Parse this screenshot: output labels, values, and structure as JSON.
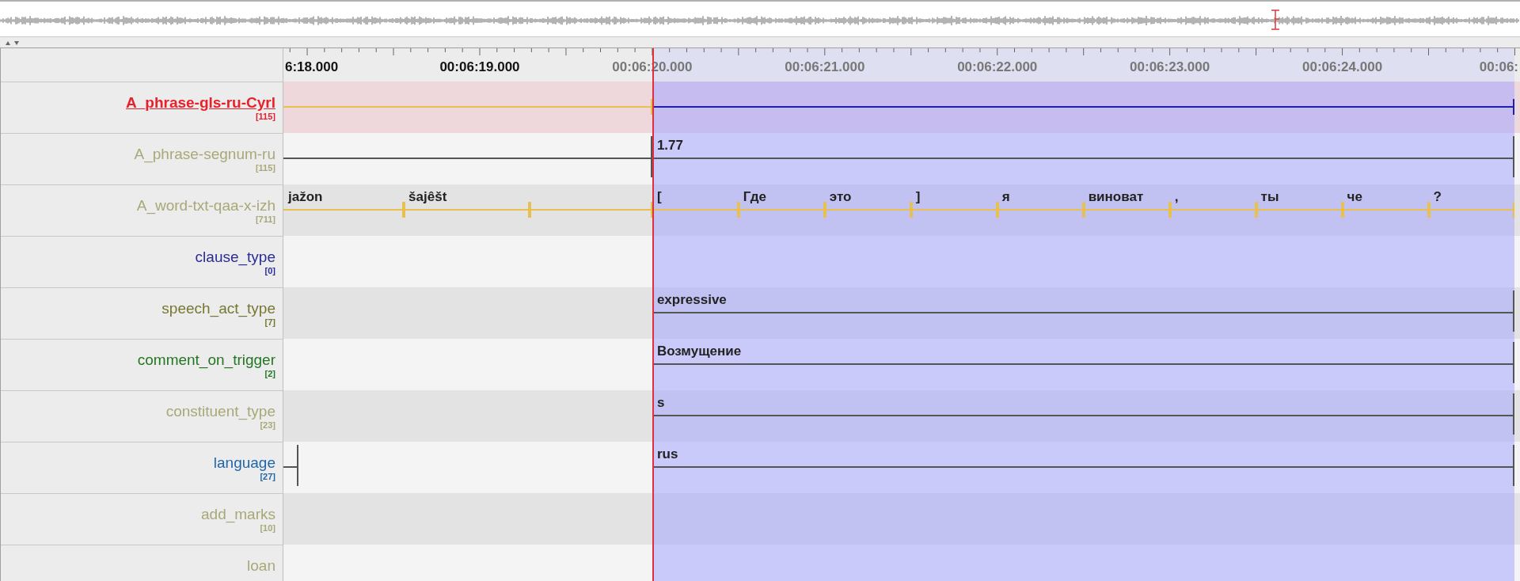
{
  "ruler": {
    "labels": [
      "6:18.000",
      "00:06:19.000",
      "00:06:20.000",
      "00:06:21.000",
      "00:06:22.000",
      "00:06:23.000",
      "00:06:24.000",
      "00:06:"
    ]
  },
  "tiers": [
    {
      "name": "A_phrase-gls-ru-Cyrl",
      "count": "[115]",
      "color": "#e8202a",
      "selected": true,
      "kind": "alignable",
      "annotations": [
        {
          "selected": false
        },
        {
          "selected": true
        }
      ]
    },
    {
      "name": "A_phrase-segnum-ru",
      "count": "[115]",
      "color": "#a8a878",
      "selected": false,
      "kind": "reference",
      "annotations": [
        {
          "selected": false
        },
        {
          "value": "1.77",
          "selected": false
        }
      ]
    },
    {
      "name": "A_word-txt-qaa-x-izh",
      "count": "[711]",
      "color": "#a8a878",
      "selected": false,
      "kind": "alignable",
      "annotations": [
        {
          "value": "jažon",
          "selected": false
        },
        {
          "value": "šajêšt",
          "selected": false
        },
        {
          "selected": false
        },
        {
          "value": "[",
          "selected": false
        },
        {
          "value": "Где",
          "selected": false
        },
        {
          "value": "это",
          "selected": false
        },
        {
          "value": "]",
          "selected": false
        },
        {
          "value": "я",
          "selected": false
        },
        {
          "value": "виноват",
          "selected": false
        },
        {
          "value": ",",
          "selected": false
        },
        {
          "value": "ты",
          "selected": false
        },
        {
          "value": "че",
          "selected": false
        },
        {
          "value": "?",
          "selected": false
        }
      ]
    },
    {
      "name": "clause_type",
      "count": "[0]",
      "color": "#2a2a99",
      "selected": false
    },
    {
      "name": "speech_act_type",
      "count": "[7]",
      "color": "#777733",
      "selected": false,
      "kind": "reference",
      "annotations": [
        {
          "value": "expressive",
          "selected": false
        }
      ]
    },
    {
      "name": "comment_on_trigger",
      "count": "[2]",
      "color": "#227722",
      "selected": false,
      "kind": "reference",
      "annotations": [
        {
          "value": "Возмущение",
          "selected": false
        }
      ]
    },
    {
      "name": "constituent_type",
      "count": "[23]",
      "color": "#a8a878",
      "selected": false,
      "kind": "reference",
      "annotations": [
        {
          "value": "s",
          "selected": false
        }
      ]
    },
    {
      "name": "language",
      "count": "[27]",
      "color": "#2266aa",
      "selected": false,
      "kind": "reference",
      "annotations": [
        {
          "selected": false
        },
        {
          "value": "rus",
          "selected": false
        }
      ]
    },
    {
      "name": "add_marks",
      "count": "[10]",
      "color": "#a8a878",
      "selected": false
    },
    {
      "name": "loan",
      "color": "#a8a878",
      "selected": false
    }
  ]
}
